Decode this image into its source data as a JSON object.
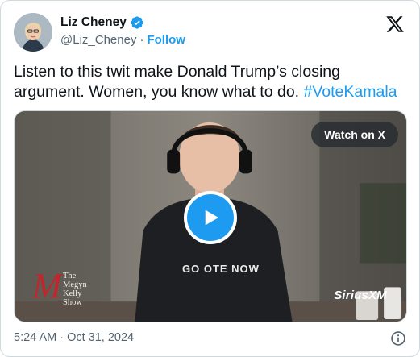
{
  "author": {
    "display_name": "Liz Cheney",
    "handle": "@Liz_Cheney",
    "separator": "·",
    "follow_label": "Follow",
    "verified_icon": "verified-badge-icon"
  },
  "tweet": {
    "text": "Listen to this twit make Donald Trump’s closing argument. Women, you know what to do.",
    "hashtag": "#VoteKamala"
  },
  "media": {
    "watch_label": "Watch on X",
    "shirt_text": "GO    OTE NOW",
    "watermark": "SiriusXM",
    "show_logo": {
      "letter": "M",
      "line1": "The",
      "line2": "Megyn",
      "line3": "Kelly",
      "line4": "Show"
    }
  },
  "footer": {
    "timestamp": "5:24 AM · Oct 31, 2024",
    "info_icon": "info-icon"
  },
  "colors": {
    "accent": "#1d9bf0",
    "text": "#0f1419",
    "muted": "#536471",
    "border": "#cfd9de"
  }
}
